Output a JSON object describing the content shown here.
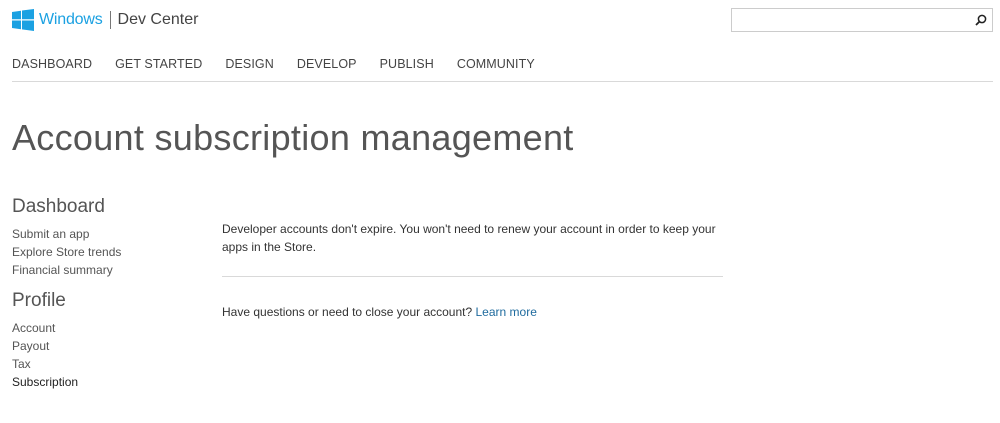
{
  "header": {
    "brand_windows": "Windows",
    "brand_dev_center": "Dev Center",
    "accent_color": "#1ba1e2",
    "search": {
      "value": "",
      "placeholder": ""
    },
    "search_icon": "search-icon"
  },
  "nav": {
    "items": [
      {
        "label": "DASHBOARD"
      },
      {
        "label": "GET STARTED"
      },
      {
        "label": "DESIGN"
      },
      {
        "label": "DEVELOP"
      },
      {
        "label": "PUBLISH"
      },
      {
        "label": "COMMUNITY"
      }
    ]
  },
  "page": {
    "title": "Account subscription management"
  },
  "sidebar": {
    "dashboard": {
      "heading": "Dashboard",
      "links": [
        "Submit an app",
        "Explore Store trends",
        "Financial summary"
      ]
    },
    "profile": {
      "heading": "Profile",
      "links": [
        "Account",
        "Payout",
        "Tax",
        "Subscription"
      ],
      "active": "Subscription"
    }
  },
  "content": {
    "expiry_text": "Developer accounts don't expire. You won't need to renew your account in order to keep your apps in the Store.",
    "questions_text": "Have questions or need to close your account?",
    "learn_more": "Learn more",
    "link_color": "#1f6b9e"
  }
}
